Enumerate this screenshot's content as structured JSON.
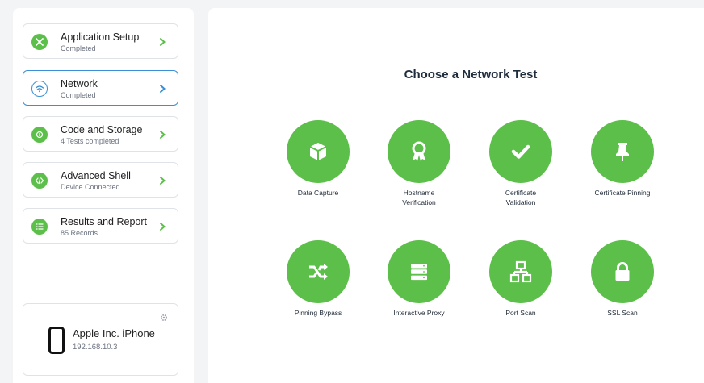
{
  "sidebar": {
    "steps": [
      {
        "title": "Application Setup",
        "subtitle": "Completed",
        "icon": "tools-icon"
      },
      {
        "title": "Network",
        "subtitle": "Completed",
        "icon": "wifi-icon"
      },
      {
        "title": "Code and Storage",
        "subtitle": "4 Tests completed",
        "icon": "fingerprint-icon"
      },
      {
        "title": "Advanced Shell",
        "subtitle": "Device Connected",
        "icon": "code-icon"
      },
      {
        "title": "Results and Report",
        "subtitle": "85 Records",
        "icon": "list-icon"
      }
    ],
    "device": {
      "name": "Apple Inc. iPhone",
      "ip": "192.168.10.3"
    }
  },
  "main": {
    "title": "Choose a Network Test",
    "tests": [
      {
        "label": "Data Capture",
        "icon": "box-icon"
      },
      {
        "label": "Hostname\nVerification",
        "icon": "award-icon"
      },
      {
        "label": "Certificate\nValidation",
        "icon": "checkmark-icon"
      },
      {
        "label": "Certificate Pinning",
        "icon": "pin-icon"
      },
      {
        "label": "Pinning Bypass",
        "icon": "shuffle-icon"
      },
      {
        "label": "Interactive Proxy",
        "icon": "server-icon"
      },
      {
        "label": "Port Scan",
        "icon": "network-icon"
      },
      {
        "label": "SSL Scan",
        "icon": "lock-icon"
      }
    ]
  },
  "colors": {
    "accent_green": "#5cbf4a",
    "active_blue": "#3b8fd6",
    "background": "#f3f4f6"
  }
}
